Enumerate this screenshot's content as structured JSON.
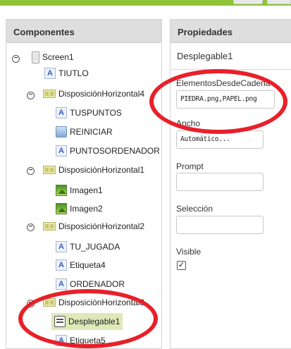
{
  "components_panel": {
    "title": "Componentes",
    "tree": [
      {
        "label": "Screen1",
        "icon": "screen-icon"
      },
      {
        "label": "TIUTLO",
        "icon": "label-icon"
      },
      {
        "label": "DisposiciónHorizontal4",
        "icon": "horizontal-arrangement-icon"
      },
      {
        "label": "TUSPUNTOS",
        "icon": "label-icon"
      },
      {
        "label": "REINICIAR",
        "icon": "button-icon"
      },
      {
        "label": "PUNTOSORDENADOR",
        "icon": "label-icon"
      },
      {
        "label": "DisposiciónHorizontal1",
        "icon": "horizontal-arrangement-icon"
      },
      {
        "label": "Imagen1",
        "icon": "image-icon"
      },
      {
        "label": "Imagen2",
        "icon": "image-icon"
      },
      {
        "label": "DisposiciónHorizontal2",
        "icon": "horizontal-arrangement-icon"
      },
      {
        "label": "TU_JUGADA",
        "icon": "label-icon"
      },
      {
        "label": "Etiqueta4",
        "icon": "label-icon"
      },
      {
        "label": "ORDENADOR",
        "icon": "label-icon"
      },
      {
        "label": "DisposiciónHorizontal3",
        "icon": "horizontal-arrangement-icon"
      },
      {
        "label": "Desplegable1",
        "icon": "spinner-icon",
        "selected": true
      },
      {
        "label": "Etiqueta5",
        "icon": "label-icon"
      }
    ],
    "label_icon_glyph": "A",
    "toggle_glyph": "⊖"
  },
  "properties_panel": {
    "title": "Propiedades",
    "component_name": "Desplegable1",
    "elements_label": "ElementosDesdeCadena",
    "elements_value": "PIEDRA.png,PAPEL.png",
    "width_label": "Ancho",
    "width_value": "Automático...",
    "prompt_label": "Prompt",
    "prompt_value": "",
    "selection_label": "Selección",
    "selection_value": "",
    "visible_label": "Visible",
    "visible_checked": true,
    "check_glyph": "☑"
  },
  "colors": {
    "top_strip": "#8fc33a",
    "annotation": "#e8202a",
    "selected_row": "#dfe8b8"
  }
}
